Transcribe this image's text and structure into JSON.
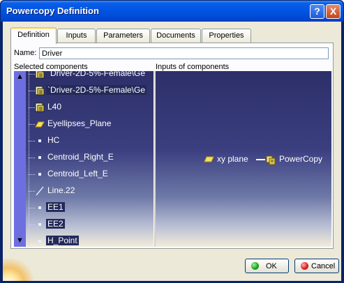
{
  "window": {
    "title": "Powercopy Definition",
    "help_label": "?",
    "close_label": "X"
  },
  "tabs": [
    "Definition",
    "Inputs",
    "Parameters",
    "Documents",
    "Properties"
  ],
  "form": {
    "name_label": "Name:",
    "name_value": "Driver",
    "selected_components_label": "Selected components",
    "inputs_of_components_label": "Inputs of components"
  },
  "tree": {
    "items": [
      {
        "label": "`Driver-2D-5%-Female\\Ge",
        "icon": "part-document-icon"
      },
      {
        "label": "`Driver-2D-5%-Female\\Ge",
        "icon": "part-document-icon"
      },
      {
        "label": "L40",
        "icon": "part-document-icon"
      },
      {
        "label": "Eyellipses_Plane",
        "icon": "plane-icon"
      },
      {
        "label": "HC",
        "icon": "point-icon"
      },
      {
        "label": "Centroid_Right_E",
        "icon": "point-icon"
      },
      {
        "label": "Centroid_Left_E",
        "icon": "point-icon"
      },
      {
        "label": "Line.22",
        "icon": "line-icon"
      },
      {
        "label": "EE1",
        "icon": "point-icon"
      },
      {
        "label": "EE2",
        "icon": "point-icon"
      },
      {
        "label": "H_Point",
        "icon": "point-icon"
      }
    ]
  },
  "inputs_flow": {
    "input_label": "xy plane",
    "target_label": "PowerCopy"
  },
  "buttons": {
    "ok_label": "OK",
    "cancel_label": "Cancel"
  },
  "colors": {
    "titlebar": "#0054e3",
    "tree_background_top": "#2c2f68",
    "scrollbar": "#6d6fe0"
  }
}
